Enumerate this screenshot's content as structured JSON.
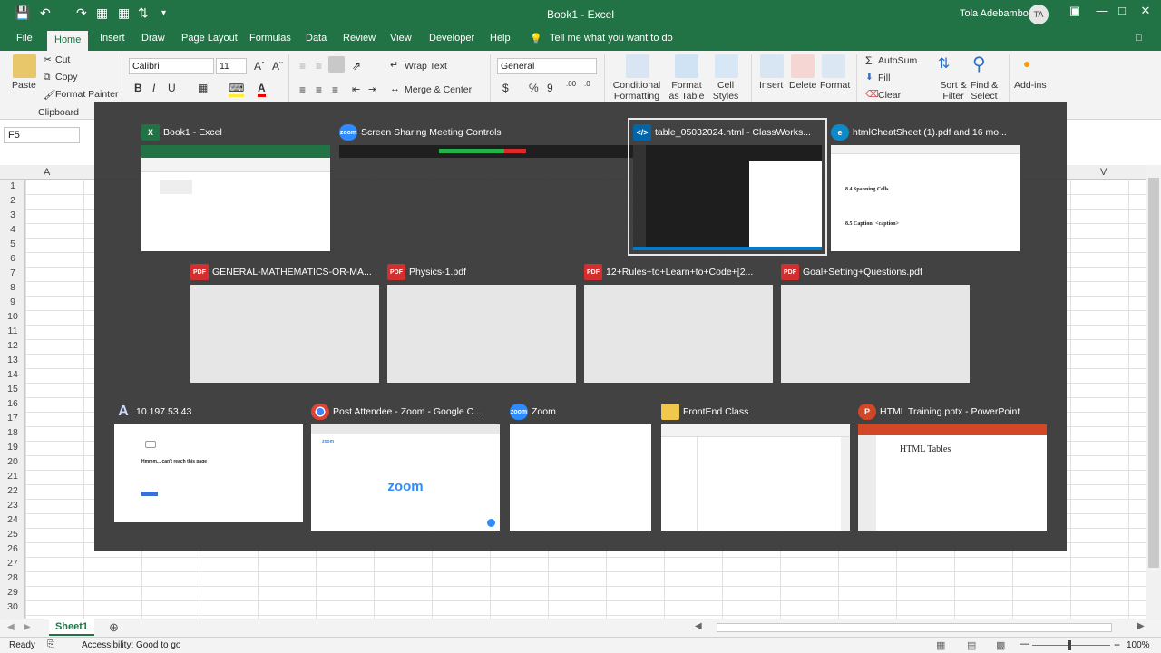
{
  "titlebar": {
    "title": "Book1  -  Excel",
    "user": "Tola Adebambo",
    "user_initials": "TA"
  },
  "menu": {
    "tabs": [
      "File",
      "Home",
      "Insert",
      "Draw",
      "Page Layout",
      "Formulas",
      "Data",
      "Review",
      "View",
      "Developer",
      "Help"
    ],
    "active": "Home",
    "tell_me": "Tell me what you want to do"
  },
  "ribbon": {
    "paste": "Paste",
    "cut": "Cut",
    "copy": "Copy",
    "format_painter": "Format Painter",
    "clipboard_group": "Clipboard",
    "font_name": "Calibri",
    "font_size": "11",
    "wrap_text": "Wrap Text",
    "merge_center": "Merge & Center",
    "number_format": "General",
    "conditional_formatting": "Conditional Formatting",
    "format_as_table": "Format as Table",
    "cell_styles": "Cell Styles",
    "insert": "Insert",
    "delete": "Delete",
    "format": "Format",
    "autosum": "AutoSum",
    "fill": "Fill",
    "clear": "Clear",
    "sort_filter": "Sort & Filter",
    "find_select": "Find & Select",
    "add_ins": "Add-ins"
  },
  "sheet": {
    "name_box": "F5",
    "visible_columns": [
      "A",
      "V"
    ],
    "rows": [
      "1",
      "2",
      "3",
      "4",
      "5",
      "6",
      "7",
      "8",
      "9",
      "10",
      "11",
      "12",
      "13",
      "14",
      "15",
      "16",
      "17",
      "18",
      "19",
      "20",
      "21",
      "22",
      "23",
      "24",
      "25",
      "26",
      "27",
      "28",
      "29",
      "30"
    ],
    "tab": "Sheet1"
  },
  "status": {
    "ready": "Ready",
    "accessibility": "Accessibility: Good to go",
    "zoom": "100%"
  },
  "switcher": {
    "windows": [
      {
        "title": "Book1 - Excel",
        "icon": "excel-icon"
      },
      {
        "title": "Screen Sharing Meeting Controls",
        "icon": "zoom-icon"
      },
      {
        "title": "table_05032024.html - ClassWorks...",
        "icon": "vscode-icon"
      },
      {
        "title": "htmlCheatSheet (1).pdf and 16 mo...",
        "icon": "edge-icon"
      },
      {
        "title": "GENERAL-MATHEMATICS-OR-MA...",
        "icon": "pdf-icon"
      },
      {
        "title": "Physics-1.pdf",
        "icon": "pdf-icon"
      },
      {
        "title": "12+Rules+to+Learn+to+Code+[2...",
        "icon": "pdf-icon"
      },
      {
        "title": "Goal+Setting+Questions.pdf",
        "icon": "pdf-icon"
      },
      {
        "title": "10.197.53.43",
        "icon": "remote-desktop-icon"
      },
      {
        "title": "Post Attendee - Zoom - Google C...",
        "icon": "chrome-icon"
      },
      {
        "title": "Zoom",
        "icon": "zoom-icon"
      },
      {
        "title": "FrontEnd Class",
        "icon": "folder-icon"
      },
      {
        "title": "HTML Training.pptx - PowerPoint",
        "icon": "powerpoint-icon"
      }
    ],
    "thumb_text": {
      "cheatsheet_heading1": "8.4    Spanning Cells",
      "cheatsheet_heading2": "8.5    Caption: <caption>",
      "rdp_error": "Hmmm... can't reach this page",
      "zoom_logo": "zoom",
      "zoom_small_logo": "zoom",
      "ppt_heading": "HTML Tables"
    }
  },
  "colors": {
    "excel_green": "#217346",
    "overlay": "#3a3a3a",
    "zoom_blue": "#2d8cff"
  }
}
